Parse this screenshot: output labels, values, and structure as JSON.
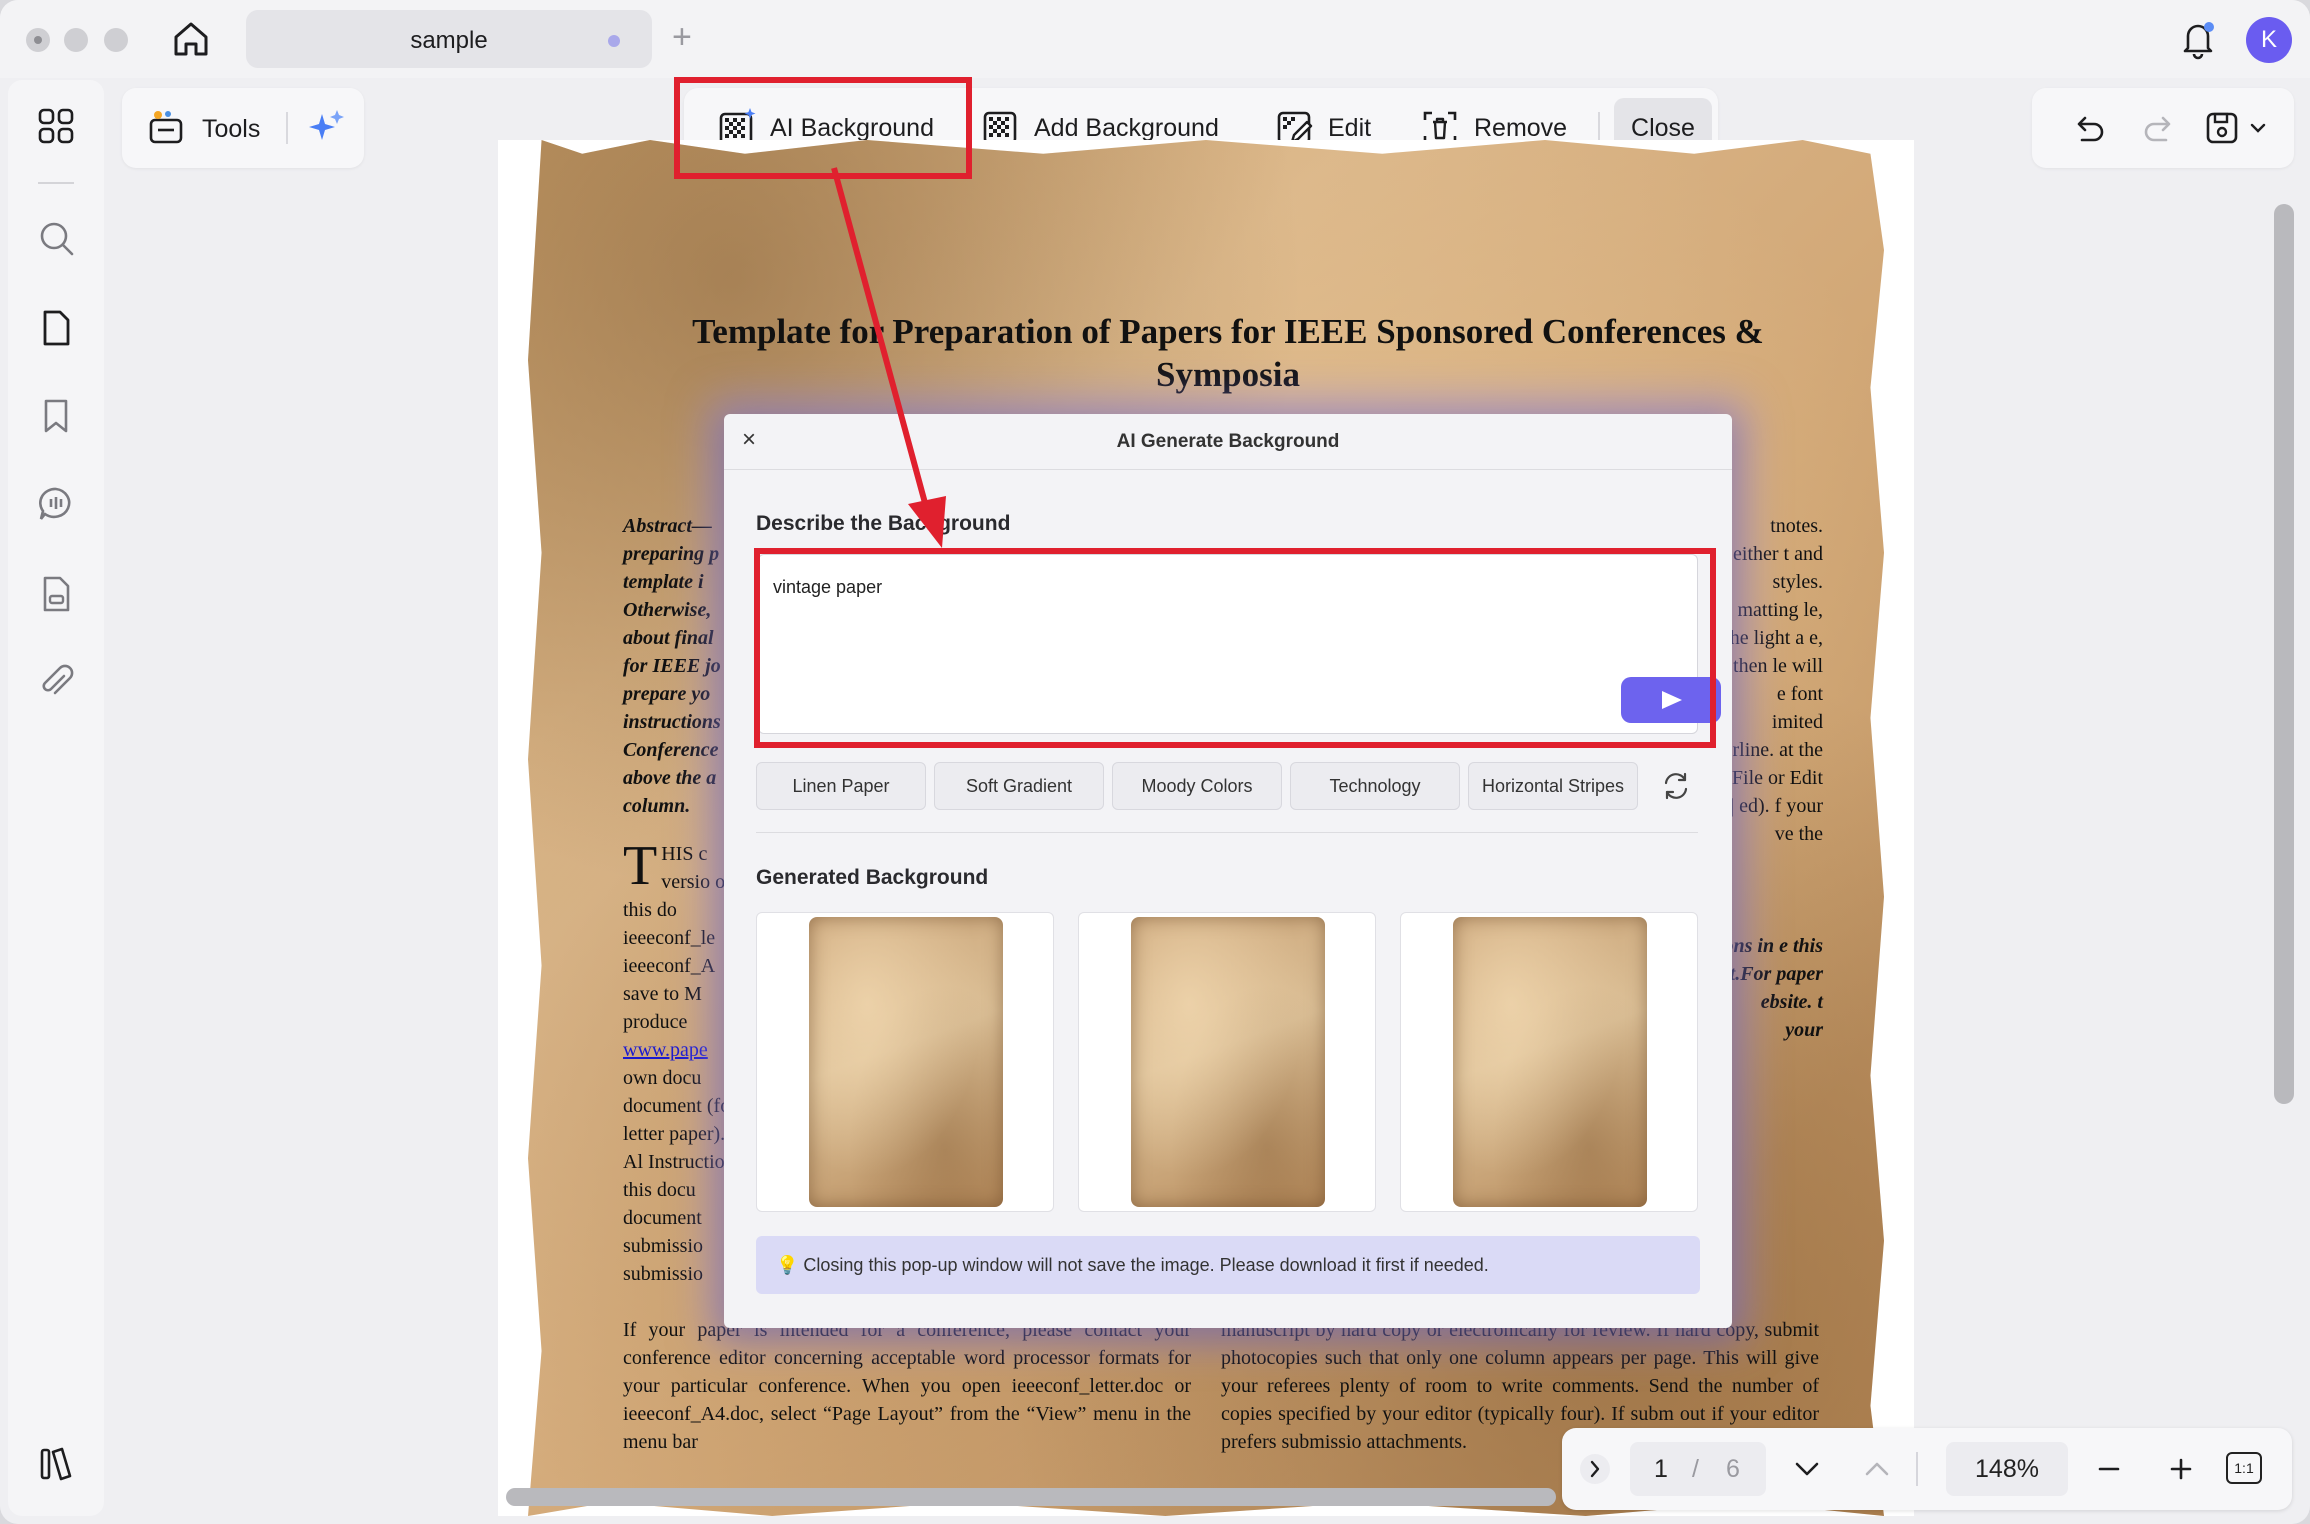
{
  "tab": {
    "title": "sample"
  },
  "user": {
    "avatar_initial": "K"
  },
  "toolbar": {
    "tools_label": "Tools",
    "ai_background_label": "AI Background",
    "add_background_label": "Add Background",
    "edit_label": "Edit",
    "remove_label": "Remove",
    "close_label": "Close"
  },
  "document": {
    "title": "Template for Preparation of Papers for IEEE Sponsored Conferences & Symposia",
    "left_col_fragment": "Abstract— preparing p template i Otherwise, about final for IEEE jo prepare yo instructions Conference above the a column.",
    "left_col_fragment_b": "HIS c versio of this do ieeeconf_le ieeeconf_A save to M produce",
    "link_text": "www.pape",
    "left_col_fragment_c": "own docu document (for letter paper). Al Instruction this docu document submissio submissio",
    "right_col_fragment": "tnotes. either t and styles. matting le, the light a e, then le will e font imited erline. at the File or Edit | ed). f your ve the",
    "right_col_fragment_b": "ons in e this t.For paper ebsite. t your",
    "bottom_left_text": "If your paper is intended for a conference, please contact your conference editor concerning acceptable word processor formats for your particular conference. When you open ieeeconf_letter.doc or ieeeconf_A4.doc, select “Page Layout” from the “View” menu in the menu bar",
    "bottom_right_text": "manuscript by hard copy or electronically for review. If hard copy, submit photocopies such that only one column appears per page. This will give your referees plenty of room to write comments. Send the number of copies specified by your editor (typically four). If subm out if your editor prefers submissio attachments."
  },
  "dialog": {
    "close_glyph": "×",
    "title": "AI Generate Background",
    "describe_label": "Describe the Background",
    "prompt_value": "vintage paper",
    "chips": [
      "Linen Paper",
      "Soft Gradient",
      "Moody Colors",
      "Technology",
      "Horizontal Stripes"
    ],
    "generated_label": "Generated Background",
    "notice": "💡 Closing this pop-up window will not save the image. Please download it first if needed."
  },
  "navigation": {
    "current_page": "1",
    "page_separator": "/",
    "total_pages": "6",
    "zoom": "148%",
    "ratio_label": "1:1"
  },
  "colors": {
    "accent": "#6d63ee",
    "annotation_red": "#e0202e",
    "avatar": "#6a5cf0"
  }
}
